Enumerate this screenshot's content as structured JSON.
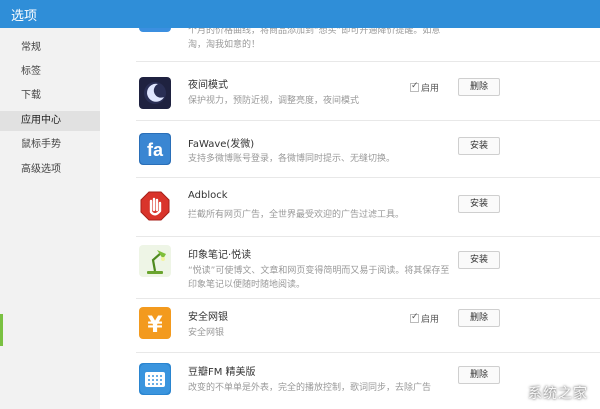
{
  "window": {
    "title": "选项"
  },
  "sidebar": {
    "items": [
      {
        "label": "常规"
      },
      {
        "label": "标签"
      },
      {
        "label": "下载"
      },
      {
        "label": "应用中心"
      },
      {
        "label": "鼠标手势"
      },
      {
        "label": "高级选项"
      }
    ],
    "active_index": 3
  },
  "apps": [
    {
      "name": "",
      "desc": "个月的价格曲线，将商品添加到“想买”即可开通降价提醒。如意淘，淘我如意的！",
      "icon": "blue-partial-icon"
    },
    {
      "name": "夜间模式",
      "desc": "保护视力，预防近视，调整亮度，夜间模式",
      "enabled_label": "启用",
      "button": "删除",
      "icon": "moon-icon"
    },
    {
      "name": "FaWave(发微)",
      "desc": "支持多微博账号登录，各微博同时提示、无缝切换。",
      "button": "安装",
      "icon": "fawave-icon"
    },
    {
      "name": "Adblock",
      "desc": "拦截所有网页广告，全世界最受欢迎的广告过滤工具。",
      "button": "安装",
      "icon": "stop-hand-icon"
    },
    {
      "name": "印象笔记·悦读",
      "desc": "“悦读”可使博文、文章和网页变得简明而又易于阅读。将其保存至印象笔记以便随时随地阅读。",
      "button": "安装",
      "icon": "lamp-icon"
    },
    {
      "name": "安全网银",
      "desc": "安全网银",
      "enabled_label": "启用",
      "button": "删除",
      "icon": "yuan-icon"
    },
    {
      "name": "豆瓣FM 精美版",
      "desc": "改变的不单单是外表，完全的播放控制，歌词同步，去除广告",
      "button": "删除",
      "icon": "radio-icon"
    }
  ],
  "watermark": "系统之家"
}
